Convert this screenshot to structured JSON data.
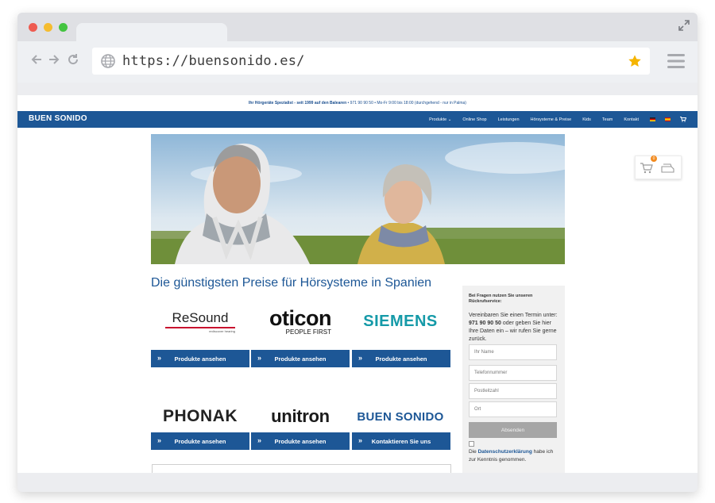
{
  "browser": {
    "url": "https://buensonido.es/"
  },
  "site": {
    "topbar": {
      "strong": "Ihr Hörgeräte Spezialist - seit 1999 auf den Balearen",
      "info": "• 971 90 90 50 • Mo-Fr 9:00 bis 18:00 (durchgehend - nur in Palma)"
    },
    "logo": "BUEN SONIDO",
    "nav": {
      "produkte": "Produkte",
      "online_shop": "Online Shop",
      "leistungen": "Leistungen",
      "hoersysteme": "Hörsysteme & Preise",
      "kids": "Kids",
      "team": "Team",
      "kontakt": "Kontakt"
    },
    "cart_count": "0",
    "heading": "Die günstigsten Preise für Hörsysteme in Spanien",
    "brands": {
      "resound": "ReSound",
      "resound_tag": "rediscover hearing",
      "oticon": "oticon",
      "oticon_tag": "PEOPLE FIRST",
      "siemens": "SIEMENS",
      "phonak": "PHONAK",
      "unitron": "unitron",
      "buensonido": "BUEN SONIDO"
    },
    "buttons": {
      "view_products": "Produkte ansehen",
      "contact": "Kontaktieren Sie uns"
    },
    "sidebar": {
      "title": "Bei Fragen nutzen Sie unseren Rückrufservice:",
      "text_pre": "Vereinbaren Sie einen Termin unter:",
      "phone": "971 90 90 50",
      "text_post": "oder geben Sie hier Ihre Daten ein – wir rufen Sie gerne zurück.",
      "name_placeholder": "Ihr Name",
      "phone_placeholder": "Telefonnummer",
      "zip_placeholder": "Postleitzahl",
      "city_placeholder": "Ort",
      "submit": "Absenden",
      "privacy_pre": "Die",
      "privacy_link": "Datenschutzerklärung",
      "privacy_post": "habe ich zur Kenntnis genommen."
    }
  },
  "colors": {
    "brand_blue": "#1d5796",
    "accent_orange": "#f28b20",
    "star_yellow": "#f5b400"
  }
}
